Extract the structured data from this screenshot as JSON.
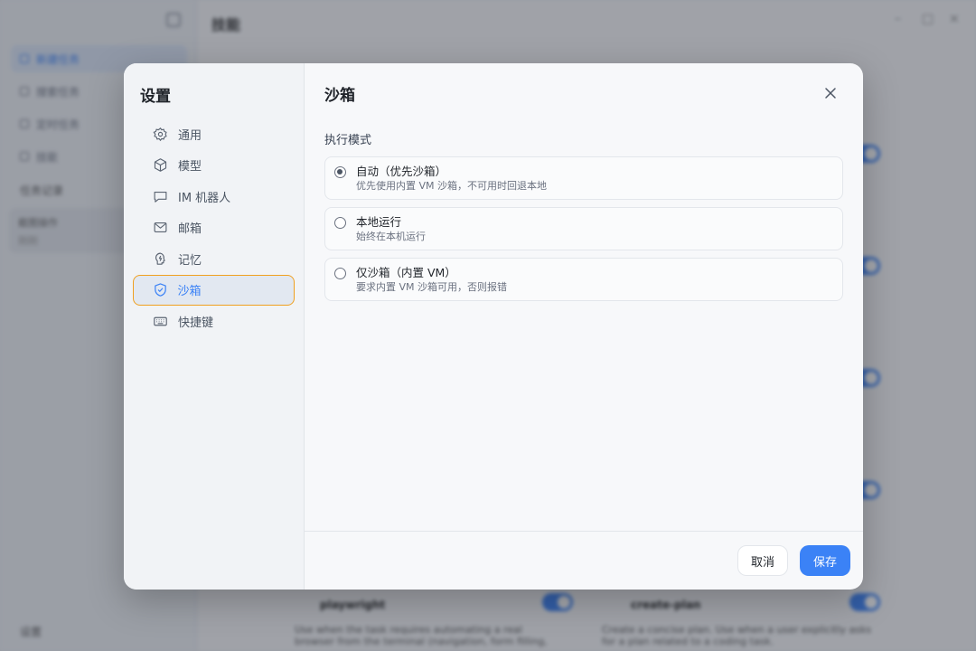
{
  "background": {
    "page_title": "技能",
    "sidebar_items": [
      "新建任务",
      "搜索任务",
      "定时任务"
    ],
    "section_label": "技能",
    "recent_label": "任务记录",
    "task_title": "截图操作",
    "task_sub": "刚刚",
    "footer_label": "设置",
    "cards": [
      {
        "title": "playwright",
        "desc": "Use when the task requires automating a real browser from the terminal (navigation, form filling, snapshots..."
      },
      {
        "title": "create-plan",
        "desc": "Create a concise plan. Use when a user explicitly asks for a plan related to a coding task."
      }
    ]
  },
  "modal": {
    "title": "设置",
    "nav": [
      {
        "label": "通用",
        "icon": "gear-icon"
      },
      {
        "label": "模型",
        "icon": "cube-icon"
      },
      {
        "label": "IM 机器人",
        "icon": "chat-bubble-icon"
      },
      {
        "label": "邮箱",
        "icon": "mail-icon"
      },
      {
        "label": "记忆",
        "icon": "brain-icon"
      },
      {
        "label": "沙箱",
        "icon": "shield-check-icon",
        "active": true
      },
      {
        "label": "快捷键",
        "icon": "keyboard-icon"
      }
    ],
    "panel": {
      "title": "沙箱",
      "section_label": "执行模式",
      "options": [
        {
          "title": "自动（优先沙箱）",
          "desc": "优先使用内置 VM 沙箱，不可用时回退本地",
          "selected": true
        },
        {
          "title": "本地运行",
          "desc": "始终在本机运行",
          "selected": false
        },
        {
          "title": "仅沙箱（内置 VM）",
          "desc": "要求内置 VM 沙箱可用，否则报错",
          "selected": false
        }
      ]
    },
    "buttons": {
      "cancel": "取消",
      "save": "保存"
    }
  },
  "colors": {
    "accent": "#3b82f6",
    "focus_ring": "#f0a020"
  }
}
